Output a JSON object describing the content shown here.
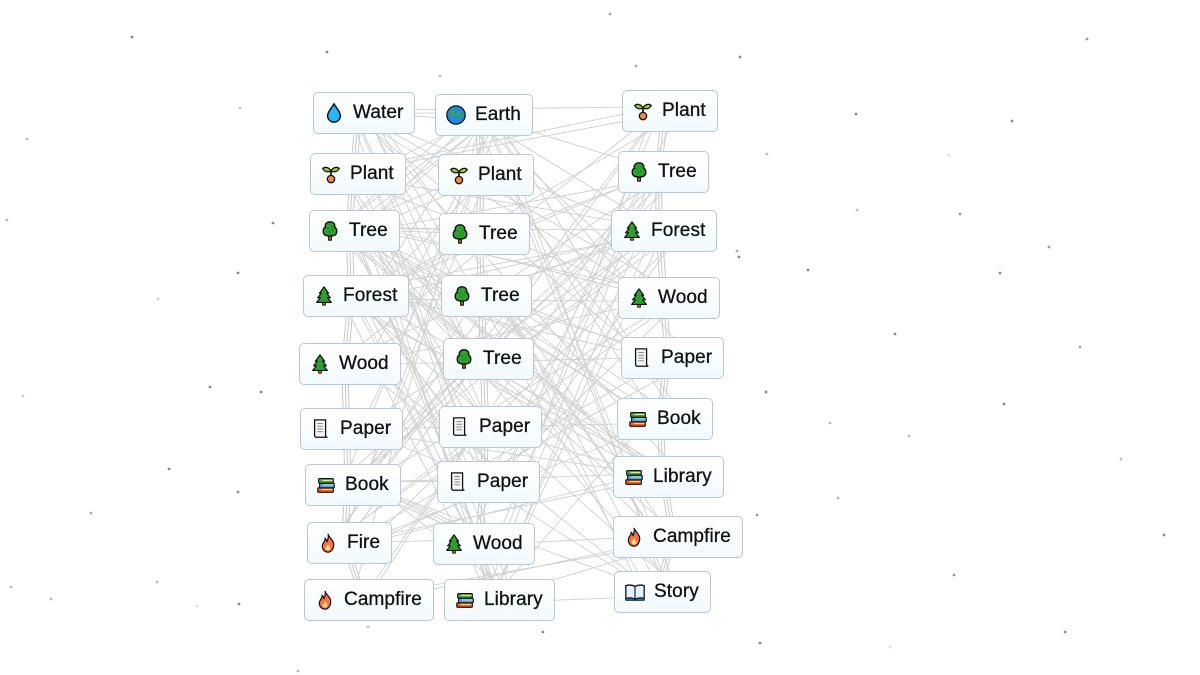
{
  "app": {
    "name": "Infinite Craft canvas",
    "colors": {
      "background": "#ffffff",
      "tile_border": "#b9c8d6",
      "tile_fill_top": "#ffffff",
      "tile_fill_bottom": "#f3fafd",
      "line_color": "#c8c8c8",
      "text": "#111111"
    }
  },
  "icons": {
    "water": "water-drop-icon",
    "earth": "globe-icon",
    "plant": "seedling-icon",
    "tree": "deciduous-tree-icon",
    "forest": "evergreen-tree-icon",
    "wood": "evergreen-tree-icon",
    "paper": "scroll-icon",
    "book": "books-icon",
    "library": "books-icon",
    "fire": "fire-icon",
    "campfire": "fire-icon",
    "story": "open-book-icon"
  },
  "columns": [
    {
      "name": "left",
      "items": [
        {
          "label": "Water",
          "icon": "water"
        },
        {
          "label": "Plant",
          "icon": "plant"
        },
        {
          "label": "Tree",
          "icon": "tree"
        },
        {
          "label": "Forest",
          "icon": "forest"
        },
        {
          "label": "Wood",
          "icon": "wood"
        },
        {
          "label": "Paper",
          "icon": "paper"
        },
        {
          "label": "Book",
          "icon": "book"
        },
        {
          "label": "Fire",
          "icon": "fire"
        },
        {
          "label": "Campfire",
          "icon": "campfire"
        }
      ]
    },
    {
      "name": "middle",
      "items": [
        {
          "label": "Earth",
          "icon": "earth"
        },
        {
          "label": "Plant",
          "icon": "plant"
        },
        {
          "label": "Tree",
          "icon": "tree"
        },
        {
          "label": "Tree",
          "icon": "tree"
        },
        {
          "label": "Tree",
          "icon": "tree"
        },
        {
          "label": "Paper",
          "icon": "paper"
        },
        {
          "label": "Paper",
          "icon": "paper"
        },
        {
          "label": "Wood",
          "icon": "wood"
        },
        {
          "label": "Library",
          "icon": "library"
        }
      ]
    },
    {
      "name": "right",
      "items": [
        {
          "label": "Plant",
          "icon": "plant"
        },
        {
          "label": "Tree",
          "icon": "tree"
        },
        {
          "label": "Forest",
          "icon": "forest"
        },
        {
          "label": "Wood",
          "icon": "wood"
        },
        {
          "label": "Paper",
          "icon": "paper"
        },
        {
          "label": "Book",
          "icon": "book"
        },
        {
          "label": "Library",
          "icon": "library"
        },
        {
          "label": "Campfire",
          "icon": "campfire"
        },
        {
          "label": "Story",
          "icon": "story"
        }
      ]
    }
  ]
}
